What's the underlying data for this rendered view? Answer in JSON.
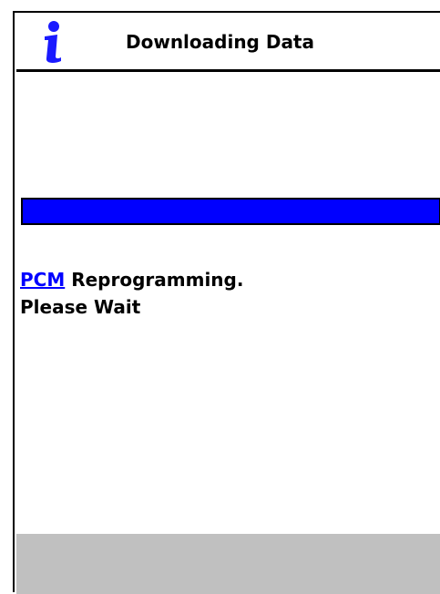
{
  "header": {
    "icon": "info-icon",
    "title": "Downloading Data"
  },
  "progress": {
    "fraction": 1.0,
    "fill_color": "#0000ff"
  },
  "message": {
    "link_text": "PCM",
    "line1_rest": " Reprogramming.",
    "line2": "Please Wait"
  },
  "colors": {
    "accent": "#0000ff",
    "footer": "#c0c0c0"
  }
}
